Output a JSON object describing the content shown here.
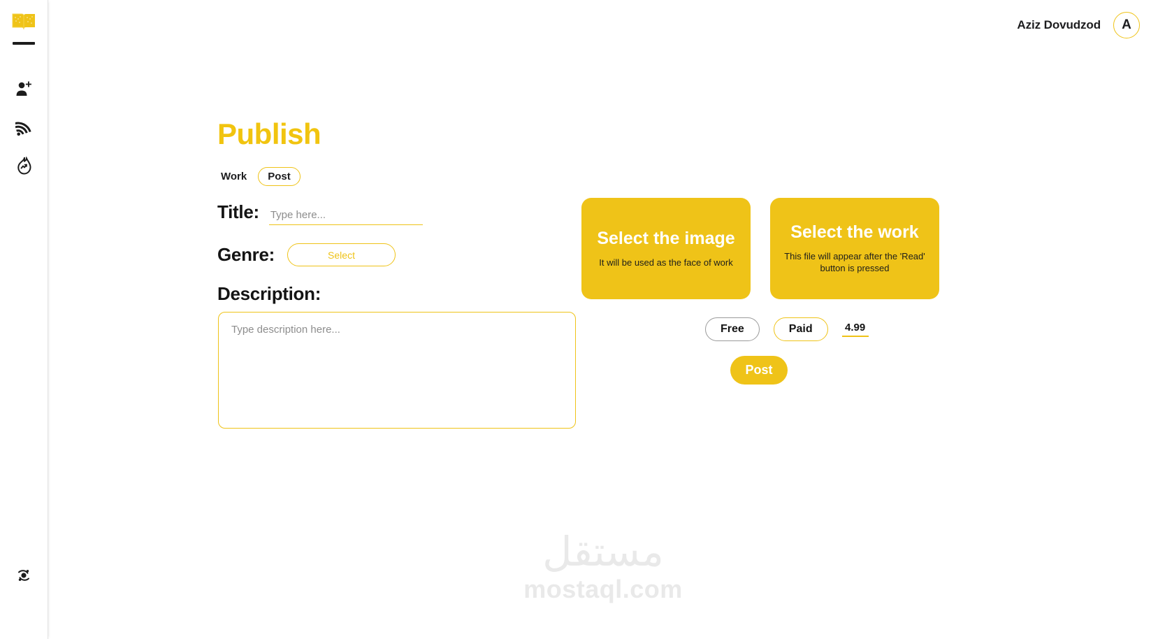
{
  "colors": {
    "accent": "#efc318",
    "title_accent": "#f1c40f",
    "text_dark": "#141414",
    "placeholder": "#8d8d8d",
    "unselected_border": "#9a9a9a",
    "watermark": "#e9e9e9"
  },
  "sidebar": {
    "logo_name": "open-book-logo",
    "items": [
      {
        "icon": "user-add-icon",
        "name": "add-user"
      },
      {
        "icon": "rss-feed-icon",
        "name": "feed"
      },
      {
        "icon": "fire-trending-icon",
        "name": "trending"
      }
    ],
    "bottom_item": {
      "icon": "settings-orbit-icon",
      "name": "settings"
    }
  },
  "topbar": {
    "user_name": "Aziz Dovudzod",
    "avatar_initial": "A"
  },
  "main": {
    "page_title": "Publish",
    "tabs": [
      {
        "label": "Work",
        "active": false
      },
      {
        "label": "Post",
        "active": true
      }
    ],
    "title_field": {
      "label": "Title:",
      "placeholder": "Type here...",
      "value": ""
    },
    "genre_field": {
      "label": "Genre:",
      "button_label": "Select"
    },
    "description_field": {
      "label": "Description:",
      "placeholder": "Type description here...",
      "value": ""
    }
  },
  "right_panel": {
    "cards": [
      {
        "title": "Select the image",
        "subtitle": "It will be used as the face of work"
      },
      {
        "title": "Select the work",
        "subtitle": "This file will appear after the 'Read' button is pressed"
      }
    ],
    "pricing": {
      "free_label": "Free",
      "paid_label": "Paid",
      "selected": "Paid",
      "price_value": "4.99"
    },
    "post_button_label": "Post"
  },
  "watermark": {
    "arabic": "مستقل",
    "latin": "mostaql.com"
  }
}
